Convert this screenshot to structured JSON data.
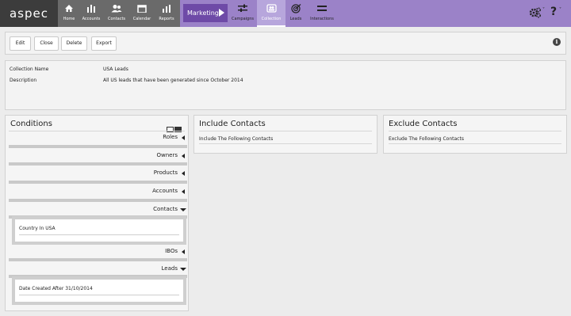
{
  "nav": {
    "logo": "aspec",
    "items": [
      {
        "label": "Home",
        "icon": "home-icon"
      },
      {
        "label": "Accounts",
        "icon": "accounts-icon"
      },
      {
        "label": "Contacts",
        "icon": "contacts-icon"
      },
      {
        "label": "Calendar",
        "icon": "calendar-icon"
      },
      {
        "label": "Reports",
        "icon": "reports-icon"
      }
    ],
    "module": "Marketing",
    "module_items": [
      {
        "label": "Campaigns",
        "icon": "campaigns-icon"
      },
      {
        "label": "Collection",
        "icon": "collection-icon"
      },
      {
        "label": "Leads",
        "icon": "leads-icon"
      },
      {
        "label": "Interactions",
        "icon": "interactions-icon"
      }
    ],
    "settings_icon": "gear-icon",
    "help_symbol": "?",
    "info_symbol": "i"
  },
  "toolbar": {
    "edit": "Edit",
    "close": "Close",
    "delete": "Delete",
    "export": "Export"
  },
  "details": {
    "name_label": "Collection Name",
    "name_value": "USA Leads",
    "desc_label": "Description",
    "desc_value": "All US leads that have been generated since October 2014"
  },
  "conditions": {
    "title": "Conditions",
    "rows": [
      "Roles",
      "Owners",
      "Products",
      "Accounts",
      "Contacts",
      "IBOs",
      "Leads"
    ],
    "contacts_rule": "Country In USA",
    "leads_rule": "Date Created After 31/10/2014"
  },
  "include": {
    "title": "Include Contacts",
    "subtitle": "Include The Following Contacts"
  },
  "exclude": {
    "title": "Exclude Contacts",
    "subtitle": "Exclude The Following Contacts"
  },
  "colors": {
    "nav_dark": "#6a6a6a",
    "module_purple": "#9b82c8",
    "module_active": "#6e4aa7"
  }
}
